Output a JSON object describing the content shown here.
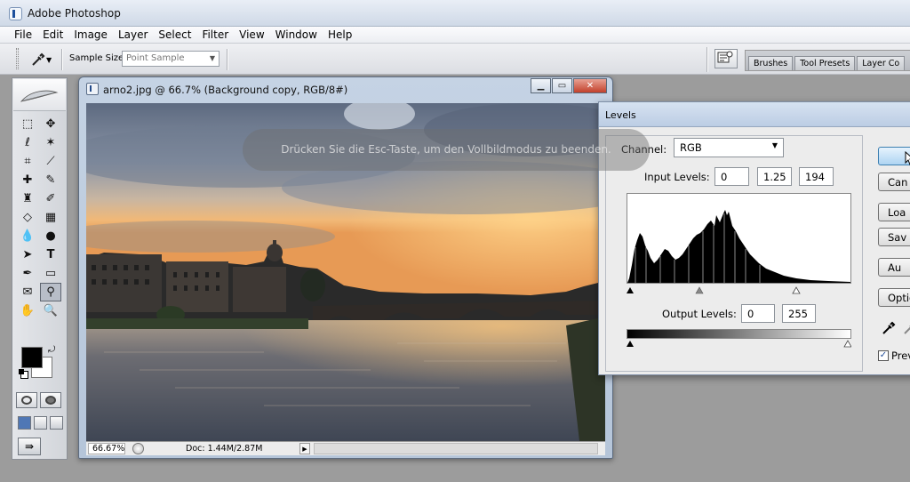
{
  "app": {
    "title": "Adobe Photoshop"
  },
  "menu": [
    "File",
    "Edit",
    "Image",
    "Layer",
    "Select",
    "Filter",
    "View",
    "Window",
    "Help"
  ],
  "options": {
    "sample_size_label": "Sample Size:",
    "sample_size_value": "Point Sample",
    "palette_tabs": [
      "Brushes",
      "Tool Presets",
      "Layer Co"
    ]
  },
  "document": {
    "title": "arno2.jpg @ 66.7% (Background copy, RGB/8#)",
    "zoom": "66.67%",
    "doc_size": "Doc: 1.44M/2.87M"
  },
  "overlay": {
    "message": "Drücken Sie die Esc-Taste, um den Vollbildmodus zu beenden."
  },
  "levels": {
    "title": "Levels",
    "channel_label": "Channel:",
    "channel_value": "RGB",
    "input_label": "Input Levels:",
    "input_black": "0",
    "input_gamma": "1.25",
    "input_white": "194",
    "output_label": "Output Levels:",
    "output_black": "0",
    "output_white": "255",
    "buttons": [
      "",
      "Can",
      "Loa",
      "Sav",
      "Au",
      "Optio"
    ],
    "preview_label": "Prev",
    "preview_checked": true
  },
  "colors": {
    "accent": "#3c7fb1",
    "foreground": "#000000",
    "background": "#ffffff"
  },
  "icons": {
    "tool_preset": "eyedropper-icon",
    "close": "close-icon",
    "minimize": "minimize-icon",
    "restore": "restore-icon"
  }
}
